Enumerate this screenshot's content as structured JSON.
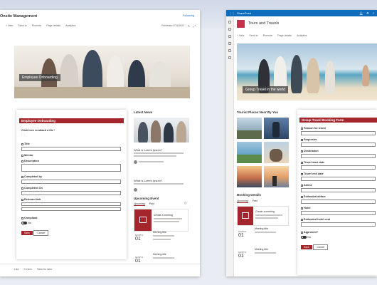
{
  "colors": {
    "brand": "#a4262c",
    "suite": "#0f6cbd"
  },
  "left": {
    "site_title": "Onsite Management",
    "following": "Following",
    "cmd": [
      "+ New",
      "Send to",
      "Promote",
      "Page details",
      "Analytics"
    ],
    "published": "Published 2/14/2022",
    "hero_caption": "Employee Onboarding",
    "form": {
      "header": "Employee Onboarding",
      "attach": "Click here to attach a file *",
      "fields": [
        {
          "label": "Title",
          "req": true
        },
        {
          "label": "Mentor",
          "req": false
        },
        {
          "label": "Description",
          "req": false
        },
        {
          "label": "Completed by",
          "req": false
        },
        {
          "label": "Completed On",
          "req": false
        },
        {
          "label": "Relevant link",
          "req": false
        },
        {
          "label": "Compliant",
          "req": false
        }
      ],
      "toggle_label": "No",
      "save": "Save",
      "cancel": "Cancel"
    },
    "latest": {
      "title": "Latest News",
      "items": [
        "What is Lorem Ipsum?",
        "What is Lorem Ipsum?"
      ]
    },
    "events": {
      "title": "Upcoming Event",
      "tabs": [
        "Upcoming",
        "Past"
      ],
      "create": "Create a meeting",
      "items": [
        {
          "month": "MONTH",
          "day": "01",
          "title": "Meeting title"
        },
        {
          "month": "MONTH",
          "day": "01",
          "title": "Meeting title"
        }
      ]
    },
    "footer": [
      "Like",
      "0 Likes",
      "Save for later"
    ]
  },
  "right": {
    "suite_name": "SharePoint",
    "site_title": "Tours and Travels",
    "cmd": [
      "+ New",
      "Send to",
      "Promote",
      "Page details",
      "Analytics"
    ],
    "hero_caption": "Group Travel in the world",
    "tourist": {
      "title": "Tourist Places Near By You"
    },
    "booking": {
      "title": "Booking Details",
      "tabs": [
        "Upcoming",
        "Past"
      ],
      "create": "Create a meeting",
      "items": [
        {
          "month": "MONTH",
          "day": "01",
          "title": "Meeting title"
        },
        {
          "month": "MONTH",
          "day": "01",
          "title": "Meeting title"
        }
      ]
    },
    "form": {
      "header": "Group Travel Booking Form",
      "fields": [
        "Reason for travel",
        "Requester",
        "Destination",
        "Travel start date",
        "Travel end date",
        "Airline",
        "Estimated airfare",
        "Hotel",
        "Estimated hotel cost",
        "Approved?"
      ],
      "toggle_label": "No",
      "save": "Save",
      "cancel": "Cancel"
    }
  }
}
